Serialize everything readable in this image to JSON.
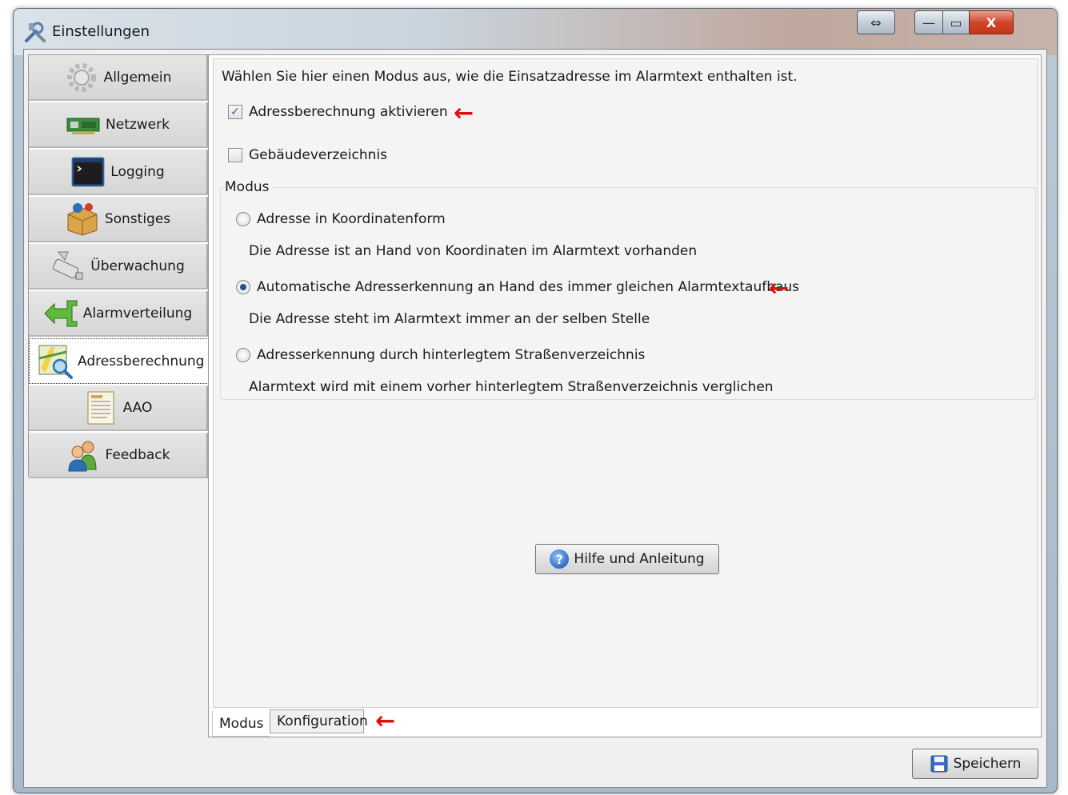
{
  "window": {
    "title": "Einstellungen",
    "buttons": {
      "resize": "⇔",
      "minimize": "—",
      "maximize": "▭",
      "close": "X"
    }
  },
  "sidebar": {
    "items": [
      {
        "label": "Allgemein",
        "icon": "gear-icon"
      },
      {
        "label": "Netzwerk",
        "icon": "network-card-icon"
      },
      {
        "label": "Logging",
        "icon": "terminal-icon"
      },
      {
        "label": "Sonstiges",
        "icon": "package-icon"
      },
      {
        "label": "Überwachung",
        "icon": "camera-icon"
      },
      {
        "label": "Alarmverteilung",
        "icon": "distribution-arrows-icon"
      },
      {
        "label": "Adressberechnung",
        "icon": "map-search-icon",
        "active": true
      },
      {
        "label": "AAO",
        "icon": "document-icon"
      },
      {
        "label": "Feedback",
        "icon": "users-icon"
      }
    ]
  },
  "main": {
    "intro": "Wählen Sie hier einen Modus aus, wie die Einsatzadresse im Alarmtext enthalten ist.",
    "checkboxes": [
      {
        "label": "Adressberechnung aktivieren",
        "checked": true
      },
      {
        "label": "Gebäudeverzeichnis",
        "checked": false
      }
    ],
    "group_label": "Modus",
    "radios": [
      {
        "label": "Adresse in Koordinatenform",
        "description": "Die Adresse ist an Hand von Koordinaten im Alarmtext vorhanden",
        "selected": false
      },
      {
        "label": "Automatische Adresserkennung an Hand des immer gleichen Alarmtextaufbaus",
        "description": "Die Adresse steht im Alarmtext immer an der selben Stelle",
        "selected": true
      },
      {
        "label": "Adresserkennung durch hinterlegtem Straßenverzeichnis",
        "description": "Alarmtext wird mit einem vorher hinterlegtem Straßenverzeichnis verglichen",
        "selected": false
      }
    ],
    "help_button": "Hilfe und Anleitung",
    "tabs": [
      {
        "label": "Modus",
        "active": true
      },
      {
        "label": "Konfiguration",
        "active": false
      }
    ]
  },
  "footer": {
    "save_button": "Speichern"
  },
  "colors": {
    "annotation_arrow": "#e01010",
    "accent": "#2e6fc4"
  }
}
